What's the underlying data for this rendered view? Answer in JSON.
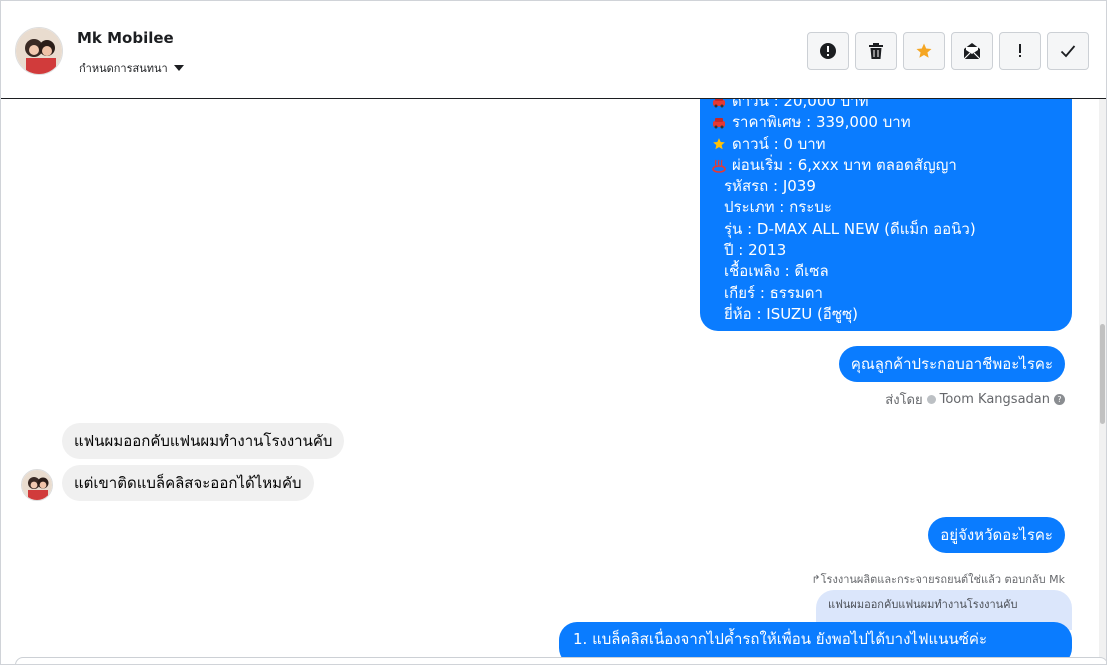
{
  "header": {
    "name": "Mk Mobilee",
    "assign_label": "กำหนดการสนทนา",
    "toolbar": [
      {
        "icon": "alert-circle-icon"
      },
      {
        "icon": "trash-icon"
      },
      {
        "icon": "star-icon"
      },
      {
        "icon": "mail-open-icon"
      },
      {
        "icon": "exclamation-icon",
        "label": "!"
      },
      {
        "icon": "check-icon"
      }
    ]
  },
  "messages": {
    "car_info": {
      "line0": "ดาวน์ : 20,000 บาท",
      "line1": "ราคาพิเศษ : 339,000 บาท",
      "line2": "ดาวน์ : 0 บาท",
      "line3": "ผ่อนเริ่ม : 6,xxx บาท ตลอดสัญญา",
      "line4": "รหัสรถ : J039",
      "line5": "ประเภท : กระบะ",
      "line6": "รุ่น : D-MAX ALL NEW (ดีแม็ก ออนิว)",
      "line7": "ปี : 2013",
      "line8": "เชื้อเพลิง : ดีเซล",
      "line9": "เกียร์ : ธรรมดา",
      "line10": "ยี่ห้อ : ISUZU (อีซูซุ)"
    },
    "out1": "คุณลูกค้าประกอบอาชีพอะไรคะ",
    "sent_by_prefix": "ส่งโดย",
    "sent_by_name": "Toom Kangsadan",
    "in1": "แฟนผมออกคับแฟนผมทำงานโรงงานคับ",
    "in2": "แต่เขาติดแบล็คลิสจะออกได้ไหมคับ",
    "out2": "อยู่จังหวัดอะไรคะ",
    "reply_meta": "โรงงานผลิตและกระจายรถยนต์ใช่แล้ว ตอบกลับ Mk",
    "quoted": "แฟนผมออกคับแฟนผมทำงานโรงงานคับ",
    "out3": "1. แบล็คลิสเนื่องจากไปค้ำรถให้เพื่อน ยังพอไปได้บางไฟแนนซ์ค่ะ"
  },
  "colors": {
    "outgoing": "#0a7cff",
    "incoming": "#f0f0f0",
    "star": "#f5a623"
  }
}
